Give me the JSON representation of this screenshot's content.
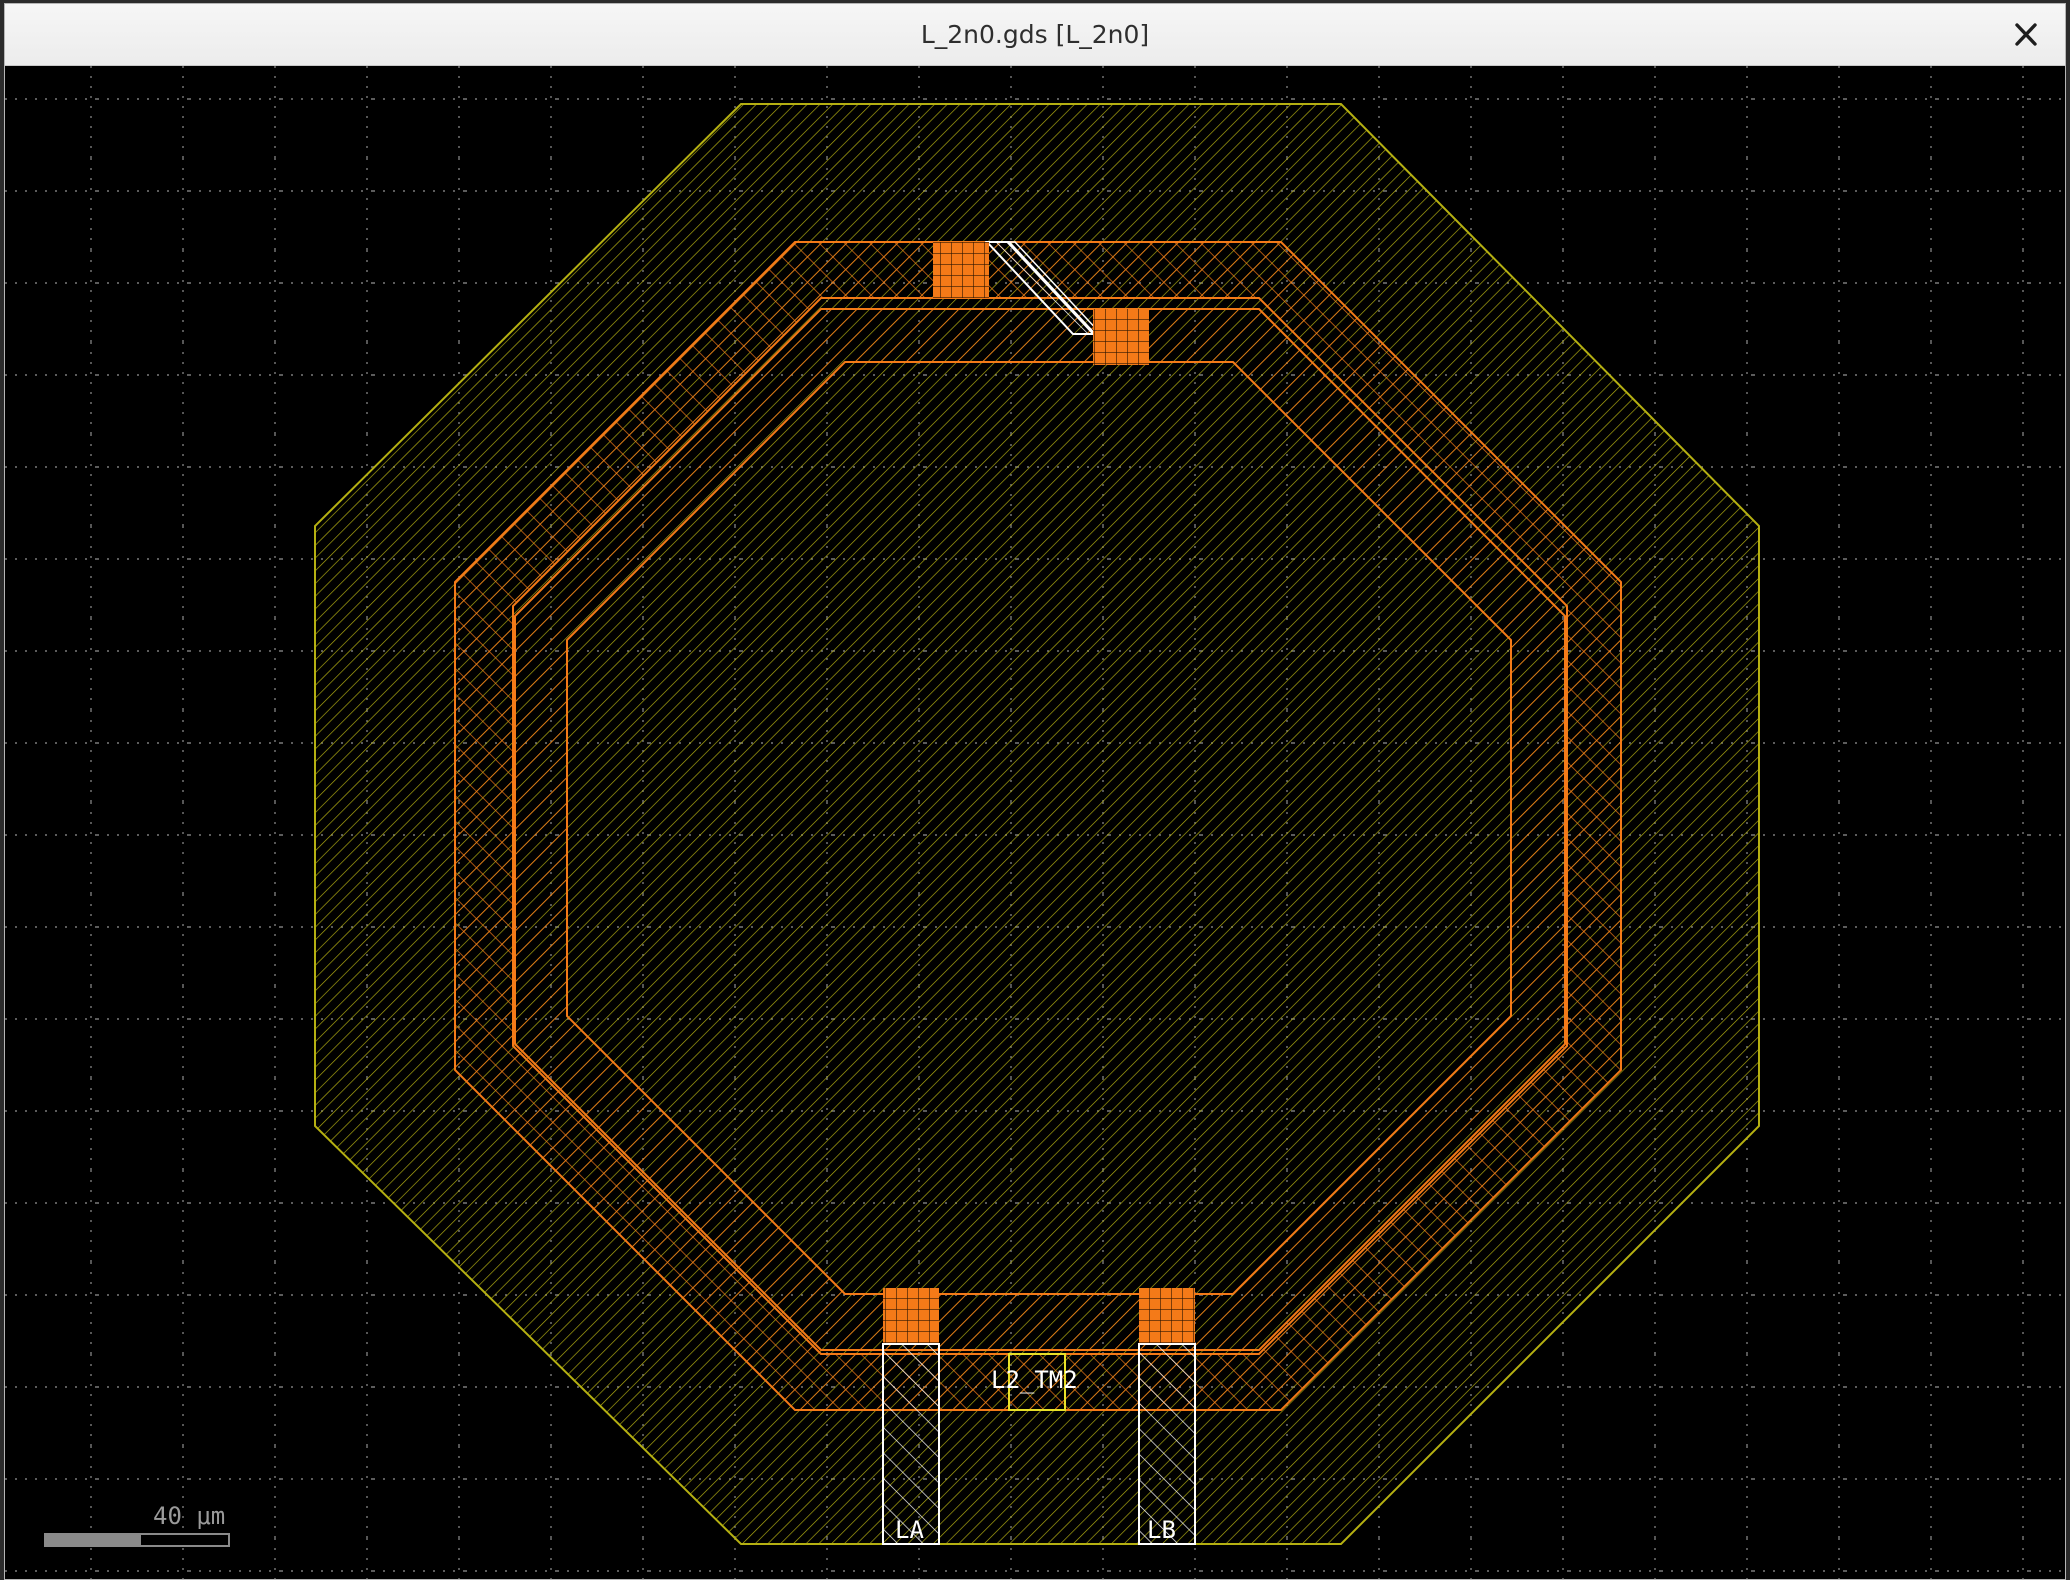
{
  "window": {
    "title": "L_2n0.gds [L_2n0]",
    "close_icon": "close-x-icon"
  },
  "layout": {
    "background": "#000000",
    "grid_color": "#8c8c8c",
    "ground_shield_color": "#b5b012",
    "metal_color": "#f47a18",
    "via_color": "#f47a18",
    "label_color": "#ffffff",
    "labels": {
      "port_a": "LA",
      "port_b": "LB",
      "center": "L2_TM2"
    },
    "scale_bar": {
      "label": "40 μm"
    }
  }
}
